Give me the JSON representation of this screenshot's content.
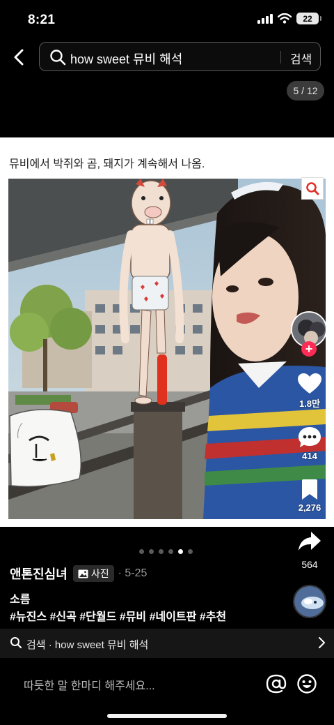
{
  "status_bar": {
    "time": "8:21",
    "battery": "22"
  },
  "search": {
    "query": "how sweet 뮤비 해석",
    "submit_label": "검색"
  },
  "page_counter": "5 / 12",
  "post": {
    "caption": "뮤비에서 박쥐와 곰, 돼지가 계속해서 나옴.",
    "image_description": "Photo of a girl on an overpass with a cartoon pig-man character and a cartoon pillow doodled on the scene",
    "likes": "1.8만",
    "comments": "414",
    "saves": "2,276",
    "shares": "564",
    "carousel": {
      "total": 6,
      "active_index": 4
    },
    "author": "앤톤진심녀",
    "type_badge": "사진",
    "date": "· 5-25",
    "title": "소름",
    "hashtags": "#뉴진스 #신곡 #단월드 #뮤비 #네이트판 #추천"
  },
  "related_search": "검색 · how sweet 뮤비 해석",
  "comment_bar": {
    "placeholder": "따듯한 말 한마디 해주세요..."
  },
  "colors": {
    "follow": "#fe2c55",
    "background": "#000000",
    "card": "#ffffff"
  },
  "icons": [
    "back-arrow-icon",
    "search-icon",
    "lens-search-icon",
    "plus-icon",
    "heart-icon",
    "comment-icon",
    "bookmark-icon",
    "share-icon",
    "photo-icon",
    "chevron-right-icon",
    "at-icon",
    "emoji-icon",
    "signal-icon",
    "wifi-icon",
    "battery-icon"
  ]
}
